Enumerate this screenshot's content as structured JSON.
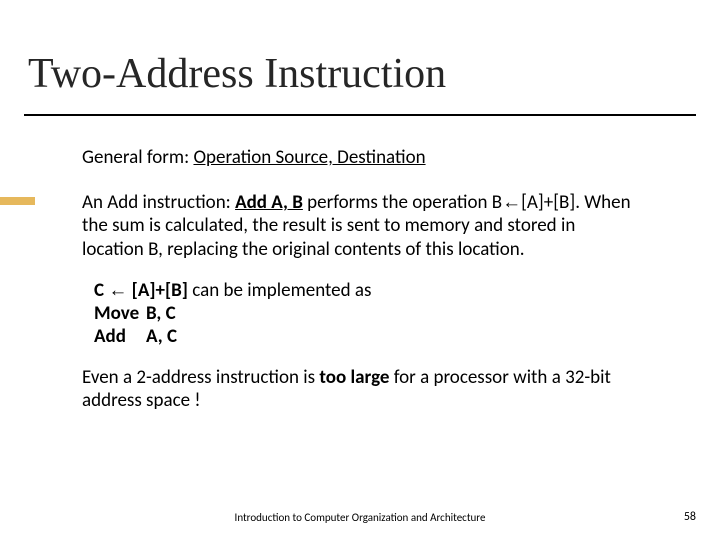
{
  "title": "Two-Address Instruction",
  "general": {
    "label": "General form:  ",
    "form": "Operation  Source, Destination"
  },
  "para": {
    "t1": "An Add instruction: ",
    "bold1": "Add A, B",
    "t2": " performs the operation B",
    "arrow": "←",
    "t3": "[A]+[B]. When the sum is calculated, the result is sent to memory and stored in location B, replacing the original contents of this location."
  },
  "impl": {
    "lhs": "C ",
    "arrow": "←",
    "rhs": " [A]+[B]",
    "tail": "  can be implemented as",
    "l2op": "Move",
    "l2args": "B, C",
    "l3op": "Add",
    "l3args": "A, C"
  },
  "note": {
    "t1": "Even a 2-address instruction is ",
    "bold": "too large",
    "t2": " for a processor with a 32-bit address space !"
  },
  "footer": {
    "center": "Introduction to Computer Organization and Architecture",
    "page": "58"
  }
}
